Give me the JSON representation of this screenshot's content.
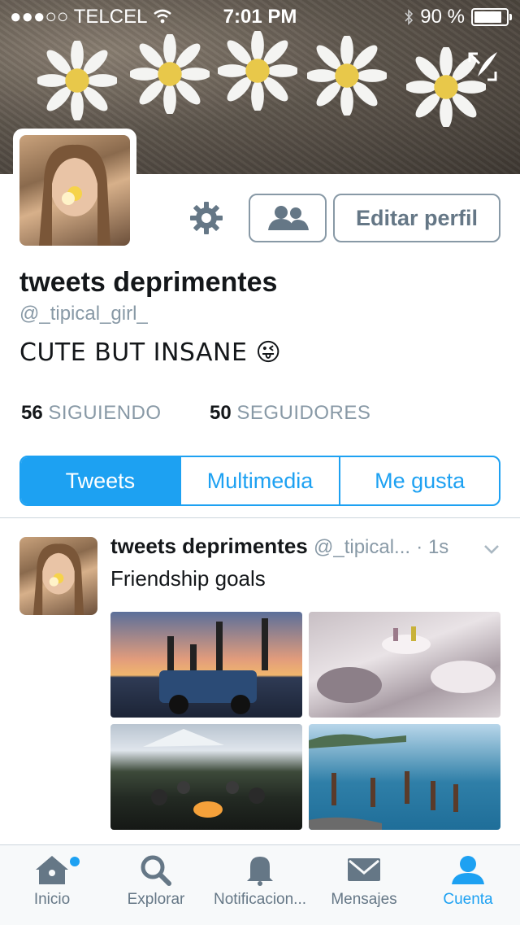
{
  "status_bar": {
    "carrier": "●●●○○ TELCEL",
    "time": "7:01 PM",
    "battery": "90 %",
    "battery_level": 0.9
  },
  "profile": {
    "name": "tweets deprimentes",
    "handle": "@_tipical_girl_",
    "bio": "CUTE BUT INSANE 😜",
    "edit_button": "Editar perfil",
    "following_count": "56",
    "following_label": "SIGUIENDO",
    "followers_count": "50",
    "followers_label": "SEGUIDORES"
  },
  "tabs": [
    {
      "label": "Tweets",
      "active": true
    },
    {
      "label": "Multimedia",
      "active": false
    },
    {
      "label": "Me gusta",
      "active": false
    }
  ],
  "tweet": {
    "name": "tweets deprimentes",
    "handle": "@_tipical...",
    "time": "· 1s",
    "text": "Friendship goals"
  },
  "tab_bar": [
    {
      "label": "Inicio",
      "icon": "home-icon"
    },
    {
      "label": "Explorar",
      "icon": "search-icon"
    },
    {
      "label": "Notificacion...",
      "icon": "bell-icon"
    },
    {
      "label": "Mensajes",
      "icon": "envelope-icon"
    },
    {
      "label": "Cuenta",
      "icon": "person-icon",
      "active": true
    }
  ],
  "colors": {
    "accent": "#1da1f2",
    "muted": "#8899a6",
    "text": "#14171a"
  }
}
